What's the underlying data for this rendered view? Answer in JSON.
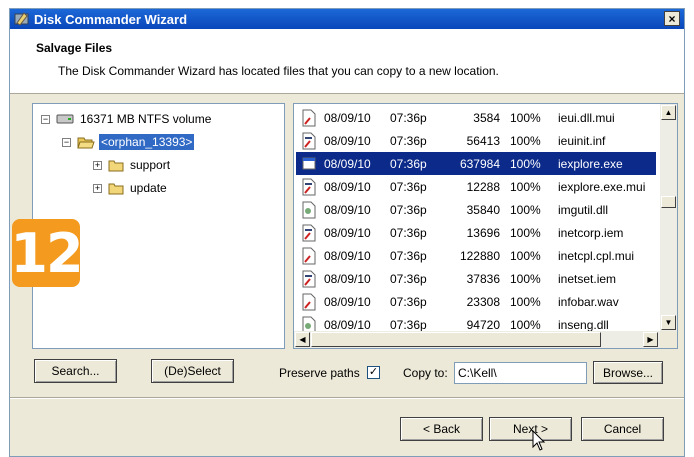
{
  "window": {
    "title": "Disk Commander Wizard",
    "close_glyph": "×"
  },
  "header": {
    "title": "Salvage Files",
    "description": "The Disk Commander Wizard has located files that you can copy to a new location."
  },
  "tree": {
    "volume": "16371 MB NTFS volume",
    "orphan": "<orphan_13393>",
    "children": [
      "support",
      "update"
    ]
  },
  "files": [
    {
      "date": "08/09/10",
      "time": "07:36p",
      "size": "3584",
      "pct": "100%",
      "name": "ieui.dll.mui"
    },
    {
      "date": "08/09/10",
      "time": "07:36p",
      "size": "56413",
      "pct": "100%",
      "name": "ieuinit.inf"
    },
    {
      "date": "08/09/10",
      "time": "07:36p",
      "size": "637984",
      "pct": "100%",
      "name": "iexplore.exe"
    },
    {
      "date": "08/09/10",
      "time": "07:36p",
      "size": "12288",
      "pct": "100%",
      "name": "iexplore.exe.mui"
    },
    {
      "date": "08/09/10",
      "time": "07:36p",
      "size": "35840",
      "pct": "100%",
      "name": "imgutil.dll"
    },
    {
      "date": "08/09/10",
      "time": "07:36p",
      "size": "13696",
      "pct": "100%",
      "name": "inetcorp.iem"
    },
    {
      "date": "08/09/10",
      "time": "07:36p",
      "size": "122880",
      "pct": "100%",
      "name": "inetcpl.cpl.mui"
    },
    {
      "date": "08/09/10",
      "time": "07:36p",
      "size": "37836",
      "pct": "100%",
      "name": "inetset.iem"
    },
    {
      "date": "08/09/10",
      "time": "07:36p",
      "size": "23308",
      "pct": "100%",
      "name": "infobar.wav"
    },
    {
      "date": "08/09/10",
      "time": "07:36p",
      "size": "94720",
      "pct": "100%",
      "name": "inseng.dll"
    }
  ],
  "controls": {
    "search": "Search...",
    "deselect": "(De)Select",
    "preserve_paths": "Preserve paths",
    "preserve_checked": "✓",
    "copy_to": "Copy to:",
    "copy_to_value": "C:\\Kell\\",
    "browse": "Browse..."
  },
  "footer": {
    "back": "< Back",
    "next": "Next >",
    "cancel": "Cancel"
  },
  "step_badge": "12",
  "colors": {
    "title_bar": "#0a46b9",
    "selection": "#0b2a8a",
    "badge": "#f39a1f"
  }
}
